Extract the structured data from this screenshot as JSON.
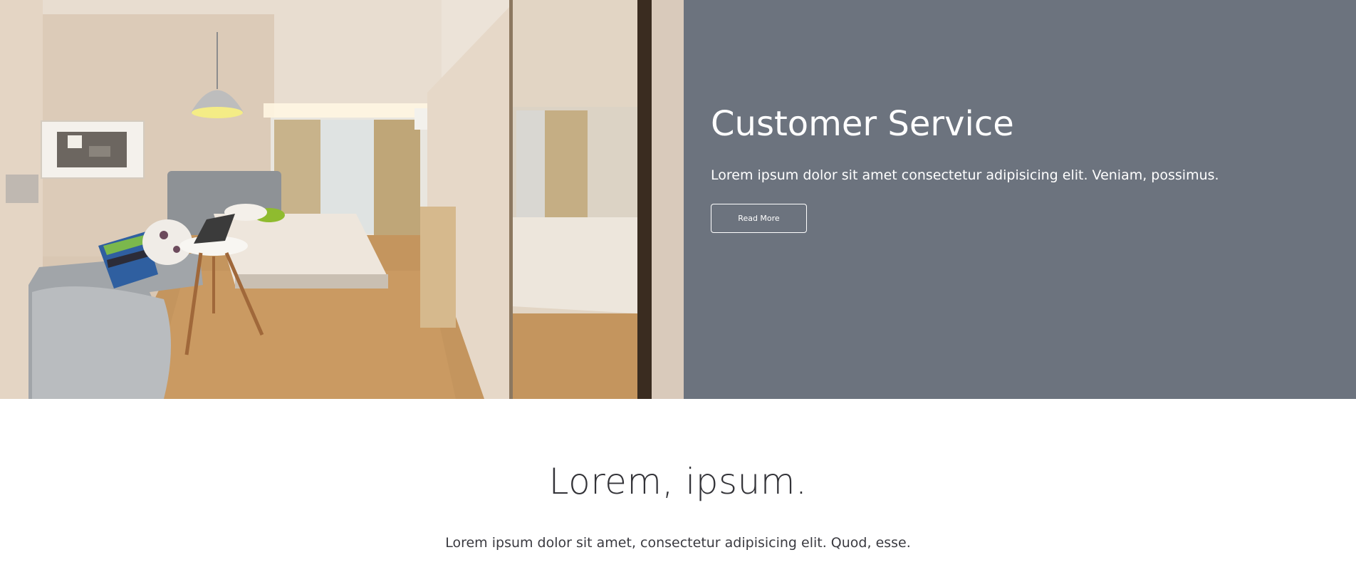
{
  "hero": {
    "image_alt": "hotel-room-photo",
    "title": "Customer Service",
    "text": "Lorem ipsum dolor sit amet consectetur adipisicing elit. Veniam, possimus.",
    "button_label": "Read More",
    "panel_color": "#6c737e"
  },
  "intro": {
    "title": "Lorem, ipsum.",
    "text": "Lorem ipsum dolor sit amet, consectetur adipisicing elit. Quod, esse."
  }
}
